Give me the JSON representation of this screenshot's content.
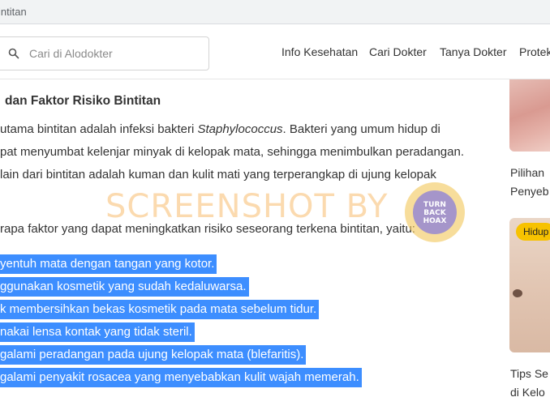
{
  "browser": {
    "url_text": "intitan"
  },
  "header": {
    "search_placeholder": "Cari di Alodokter",
    "nav": [
      "Info Kesehatan",
      "Cari Dokter",
      "Tanya Dokter",
      "Protek"
    ]
  },
  "article": {
    "heading": "dan Faktor Risiko Bintitan",
    "para1": {
      "line1_before": "utama bintitan adalah infeksi bakteri ",
      "line1_italic": "Staphylococcus",
      "line1_after": ". Bakteri yang umum hidup di",
      "line2": "pat menyumbat kelenjar minyak di kelopak mata, sehingga menimbulkan peradangan.",
      "line3": "lain dari bintitan adalah kuman dan kulit mati yang terperangkap di ujung kelopak"
    },
    "para2": "rapa faktor yang dapat meningkatkan risiko seseorang terkena bintitan, yaitu:",
    "list": [
      "yentuh mata dengan tangan yang kotor.",
      "ggunakan kosmetik yang sudah kedaluwarsa.",
      "k membersihkan bekas kosmetik pada mata sebelum tidur.",
      "nakai lensa kontak yang tidak steril.",
      "galami peradangan pada ujung kelopak mata (blefaritis).",
      "galami penyakit rosacea yang menyebabkan kulit wajah memerah."
    ]
  },
  "watermark": {
    "text": "SCREENSHOT BY",
    "badge_lines": [
      "TURN",
      "BACK",
      "HOAX"
    ]
  },
  "sidebar": {
    "card1_lines": [
      "Pilihan",
      "Penyeb"
    ],
    "card2_badge": "Hidup",
    "card2_lines": [
      "Tips Se",
      "di Kelo"
    ]
  },
  "colors": {
    "selection": "#3d8eff",
    "badge": "#f7c200",
    "watermark": "#f7bc6e"
  }
}
